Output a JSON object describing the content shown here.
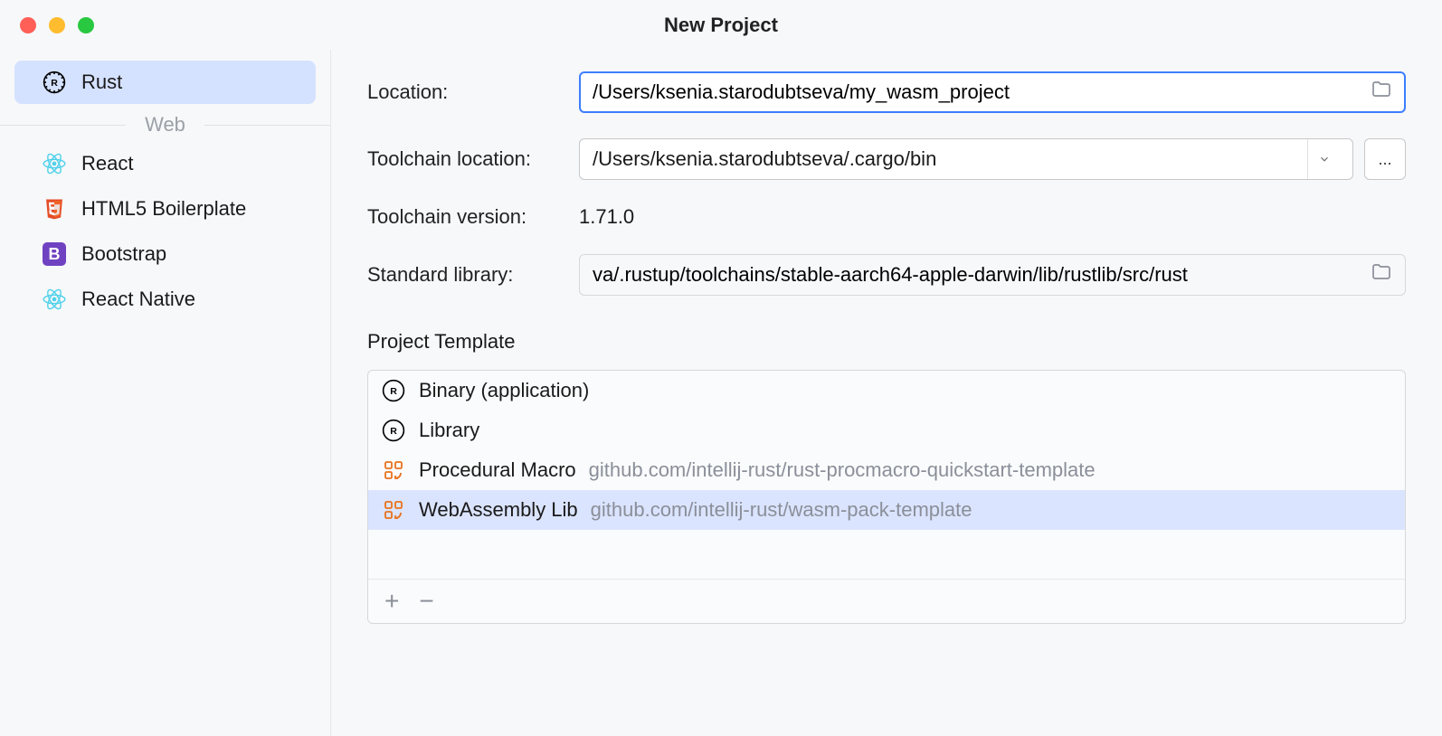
{
  "window": {
    "title": "New Project"
  },
  "sidebar": {
    "items": [
      {
        "label": "Rust",
        "icon": "rust"
      }
    ],
    "section_label": "Web",
    "web_items": [
      {
        "label": "React",
        "icon": "react"
      },
      {
        "label": "HTML5 Boilerplate",
        "icon": "html5"
      },
      {
        "label": "Bootstrap",
        "icon": "bootstrap"
      },
      {
        "label": "React Native",
        "icon": "react"
      }
    ]
  },
  "form": {
    "location_label": "Location:",
    "location_value": "/Users/ksenia.starodubtseva/my_wasm_project",
    "toolchain_location_label": "Toolchain location:",
    "toolchain_location_value": "/Users/ksenia.starodubtseva/.cargo/bin",
    "toolchain_version_label": "Toolchain version:",
    "toolchain_version_value": "1.71.0",
    "stdlib_label": "Standard library:",
    "stdlib_value": "va/.rustup/toolchains/stable-aarch64-apple-darwin/lib/rustlib/src/rust",
    "ellipsis": "..."
  },
  "templates": {
    "heading": "Project Template",
    "items": [
      {
        "label": "Binary (application)",
        "sub": "",
        "icon": "rust"
      },
      {
        "label": "Library",
        "sub": "",
        "icon": "rust"
      },
      {
        "label": "Procedural Macro",
        "sub": "github.com/intellij-rust/rust-procmacro-quickstart-template",
        "icon": "macro"
      },
      {
        "label": "WebAssembly Lib",
        "sub": "github.com/intellij-rust/wasm-pack-template",
        "icon": "macro"
      }
    ],
    "selected_index": 3
  }
}
